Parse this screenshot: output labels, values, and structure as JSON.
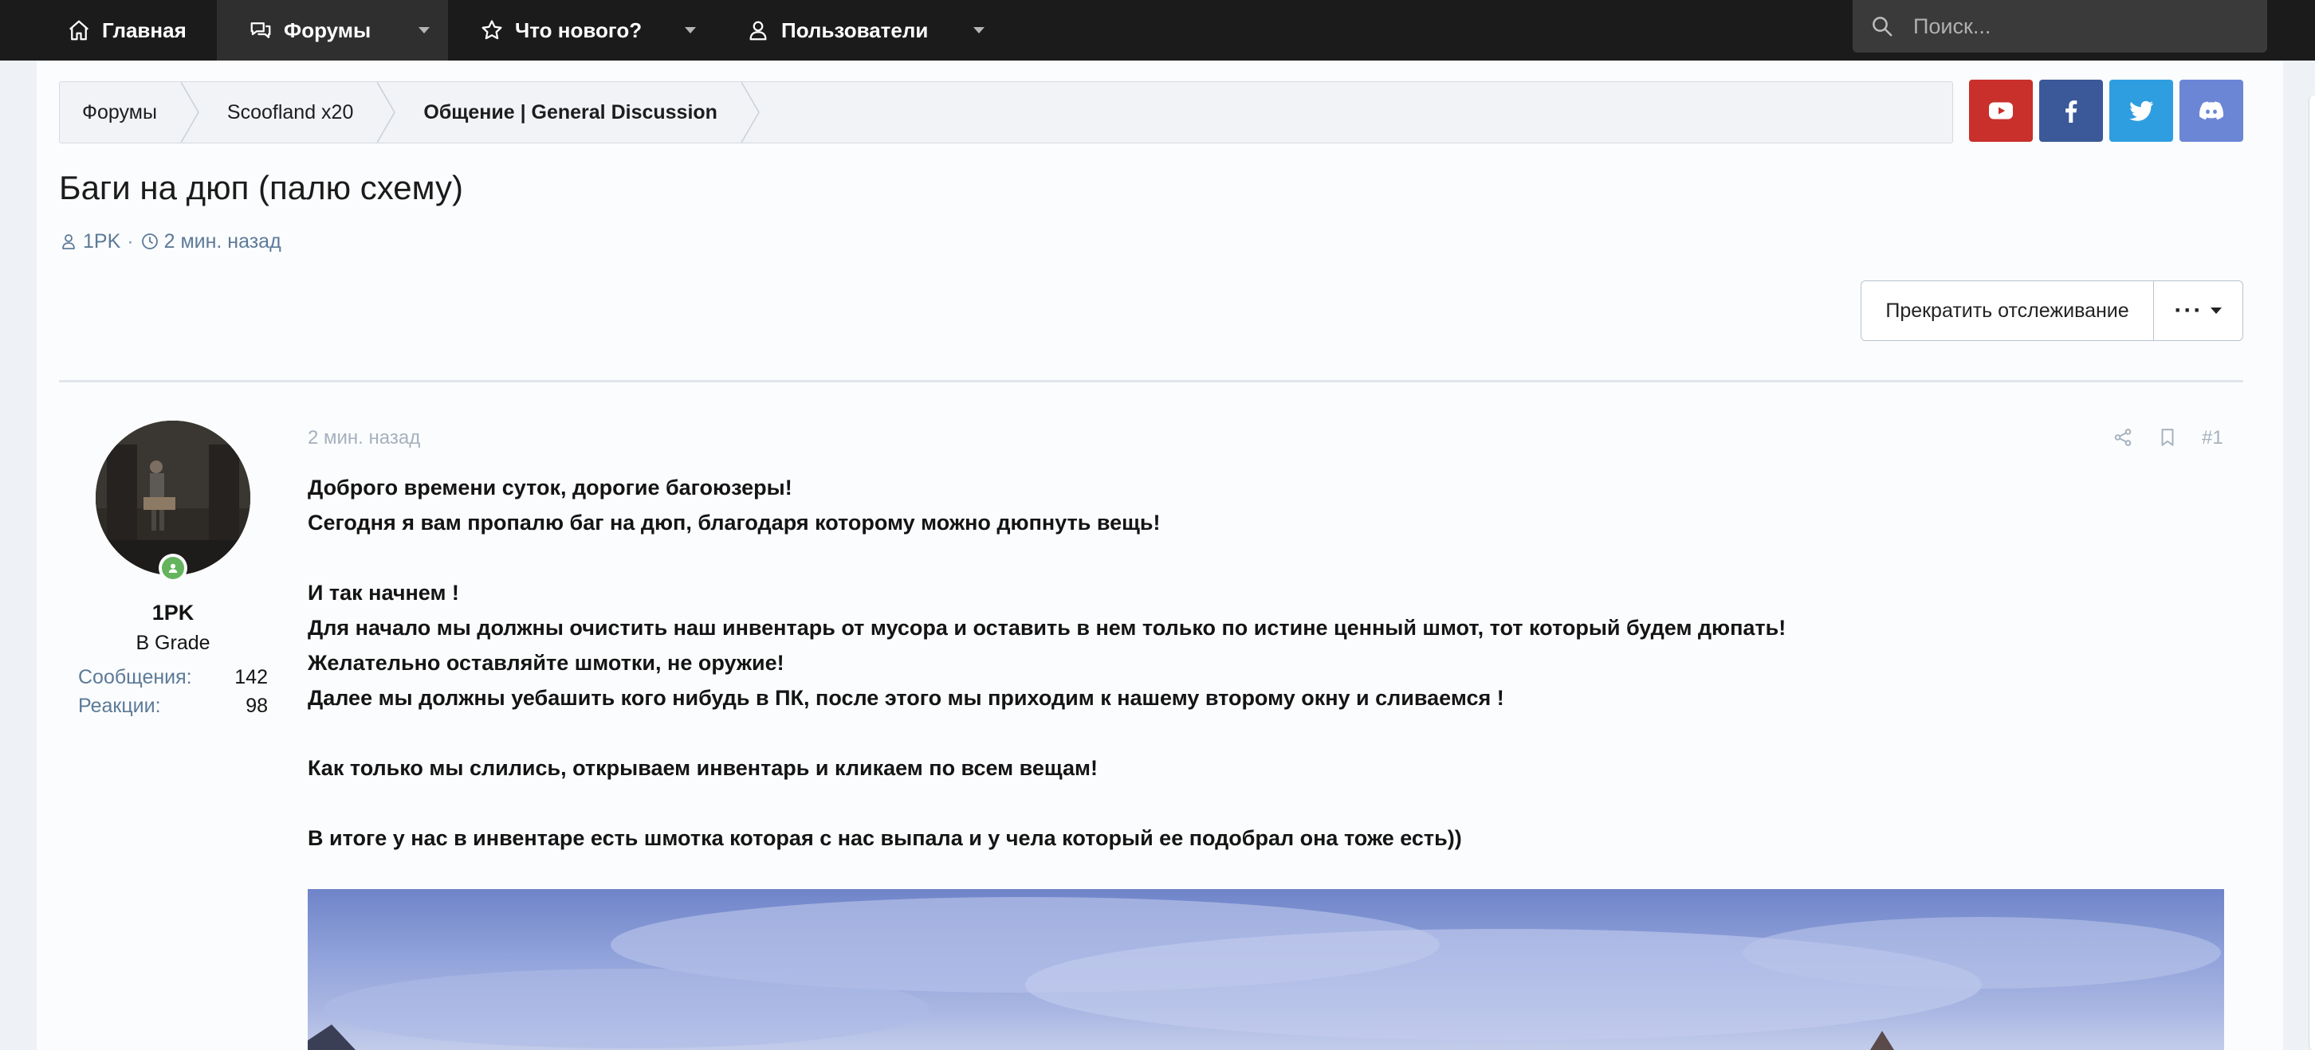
{
  "nav": {
    "home": "Главная",
    "forums": "Форумы",
    "whats_new": "Что нового?",
    "users": "Пользователи",
    "search_placeholder": "Поиск..."
  },
  "breadcrumb": {
    "items": [
      "Форумы",
      "Scoofland x20",
      "Общение | General Discussion"
    ]
  },
  "social": [
    {
      "name": "youtube",
      "color": "#c9302c"
    },
    {
      "name": "facebook",
      "color": "#3b5998"
    },
    {
      "name": "twitter",
      "color": "#2f9ee1"
    },
    {
      "name": "discord",
      "color": "#6c86d6"
    }
  ],
  "thread": {
    "title": "Баги на дюп (палю схему)",
    "author": "1PK",
    "separator": "·",
    "time": "2 мин. назад",
    "watch_button": "Прекратить отслеживание",
    "more_button": "···"
  },
  "post": {
    "username": "1PK",
    "user_title": "B Grade",
    "stats": [
      {
        "label": "Сообщения:",
        "value": "142"
      },
      {
        "label": "Реакции:",
        "value": "98"
      }
    ],
    "date": "2 мин. назад",
    "number": "#1",
    "lines": [
      "Доброго времени суток, дорогие багоюзеры!",
      "Сегодня я вам пропалю баг на дюп, благодаря которому можно дюпнуть вещь!",
      "",
      "И так начнем !",
      "Для начало мы должны очистить наш инвентарь от мусора и оставить в нем только по истине ценный шмот, тот который будем дюпать!",
      "Желательно оставляйте шмотки, не оружие!",
      "Далее мы должны уебашить кого нибудь в ПК, после этого мы приходим к нашему второму окну и сливаемся !",
      "",
      "Как только мы слились, открываем инвентарь и кликаем по всем вещам!",
      "",
      "В итоге у нас в инвентаре есть шмотка которая с нас выпала и у чела который ее подобрал она тоже есть))"
    ]
  },
  "colors": {
    "topbar": "#1b1b1b",
    "link": "#5c7a99",
    "online": "#63b45d"
  }
}
